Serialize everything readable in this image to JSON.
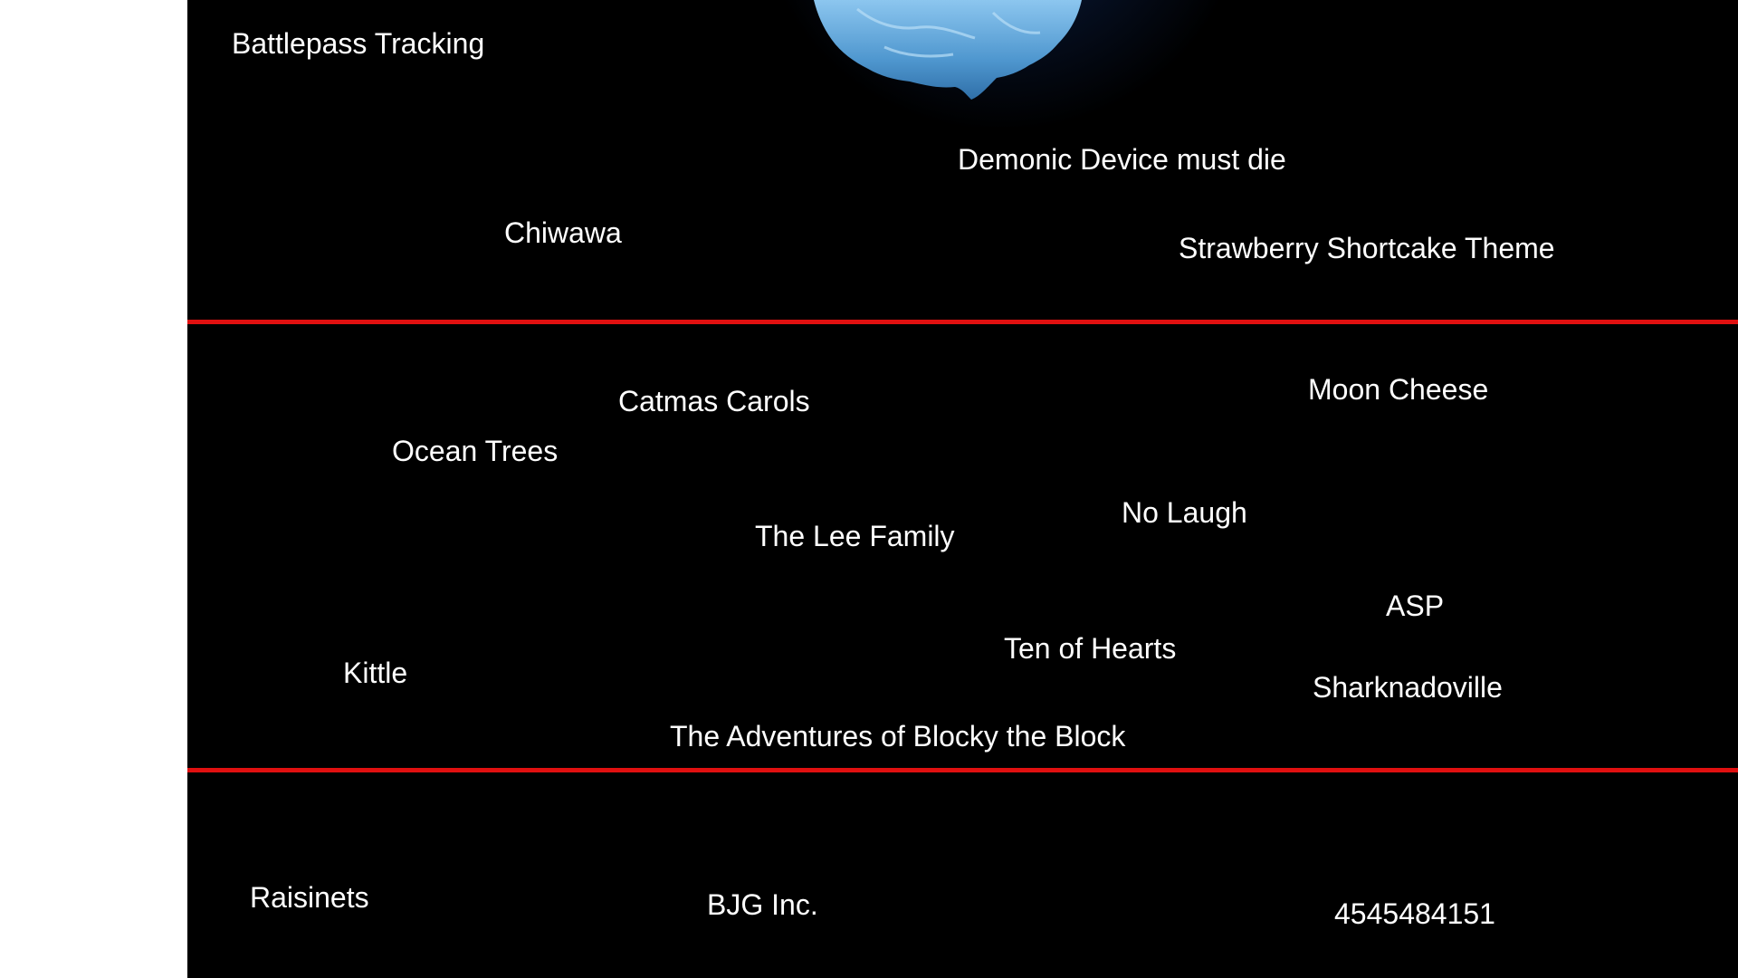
{
  "slide": {
    "title": "Battlepass Tracking",
    "tier_top": [
      "Demonic Device must die",
      "Chiwawa",
      "Strawberry Shortcake Theme"
    ],
    "tier_middle": [
      "Catmas Carols",
      "Moon Cheese",
      "Ocean Trees",
      "No Laugh",
      "The Lee Family",
      "ASP",
      "Ten of Hearts",
      "Kittle",
      "Sharknadoville",
      "The Adventures of Blocky the Block"
    ],
    "tier_bottom": [
      "Raisinets",
      "BJG Inc.",
      "4545484151"
    ]
  },
  "colors": {
    "background": "#000000",
    "divider": "#e01010",
    "text": "#ffffff",
    "iceberg": "#5fa8d8"
  },
  "icons": [
    "iceberg-icon"
  ]
}
